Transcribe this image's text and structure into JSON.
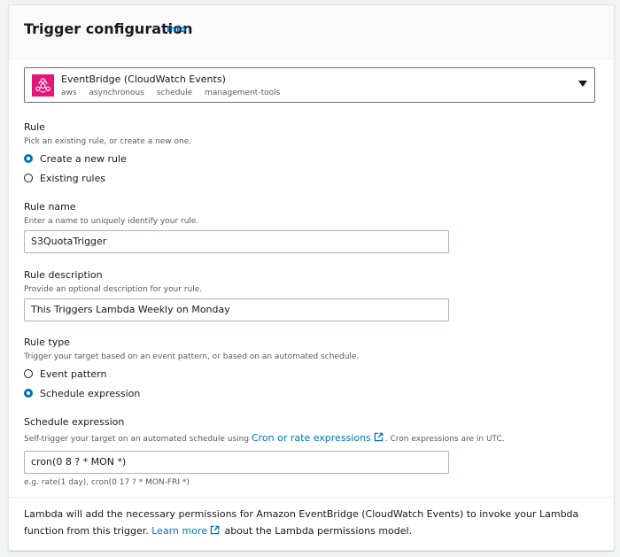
{
  "header": {
    "title": "Trigger configuration",
    "info": "Info"
  },
  "trigger_select": {
    "name": "EventBridge (CloudWatch Events)",
    "tags": [
      "aws",
      "asynchronous",
      "schedule",
      "management-tools"
    ],
    "icon": "eventbridge-icon",
    "icon_color": "#e7157b"
  },
  "rule": {
    "label": "Rule",
    "description": "Pick an existing rule, or create a new one.",
    "options": [
      {
        "label": "Create a new rule",
        "checked": true
      },
      {
        "label": "Existing rules",
        "checked": false
      }
    ]
  },
  "rule_name": {
    "label": "Rule name",
    "description": "Enter a name to uniquely identify your rule.",
    "value": "S3QuotaTrigger"
  },
  "rule_description": {
    "label": "Rule description",
    "description": "Provide an optional description for your rule.",
    "value": "This Triggers Lambda Weekly on Monday"
  },
  "rule_type": {
    "label": "Rule type",
    "description": "Trigger your target based on an event pattern, or based on an automated schedule.",
    "options": [
      {
        "label": "Event pattern",
        "checked": false
      },
      {
        "label": "Schedule expression",
        "checked": true
      }
    ]
  },
  "schedule": {
    "label": "Schedule expression",
    "desc_before": "Self-trigger your target on an automated schedule using ",
    "desc_link": "Cron or rate expressions",
    "desc_after": ". Cron expressions are in UTC.",
    "value": "cron(0 8 ? * MON *)",
    "hint": "e.g. rate(1 day), cron(0 17 ? * MON-FRI *)"
  },
  "footer": {
    "before": "Lambda will add the necessary permissions for Amazon EventBridge (CloudWatch Events) to invoke your Lambda function from this trigger. ",
    "link": "Learn more",
    "after": " about the Lambda permissions model."
  },
  "colors": {
    "accent": "#0073bb",
    "brand": "#e7157b"
  }
}
